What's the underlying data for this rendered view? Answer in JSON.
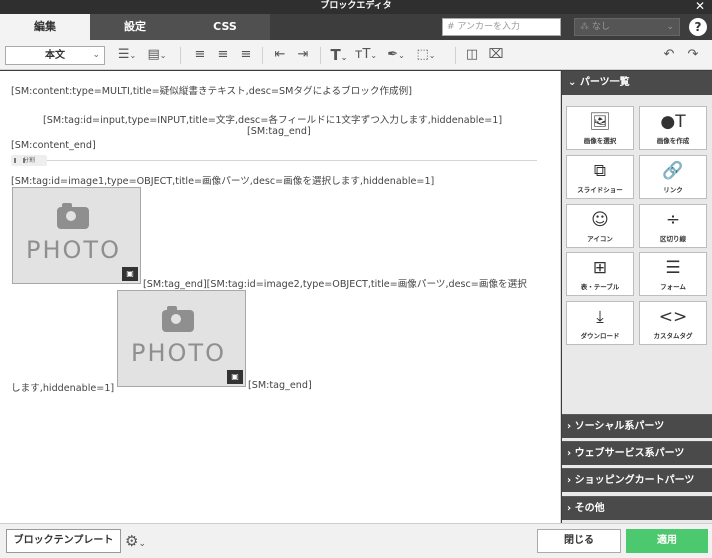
{
  "window": {
    "title": "ブロックエディタ",
    "close_symbol": "✕"
  },
  "tabs": [
    {
      "label": "編集"
    },
    {
      "label": "設定"
    },
    {
      "label": "CSS"
    }
  ],
  "anchor": {
    "placeholder": "# アンカーを入力",
    "value": ""
  },
  "link_select": {
    "value": "なし"
  },
  "help_symbol": "?",
  "toolbar": {
    "style_select": "本文"
  },
  "editor": {
    "line1": "[SM:content:type=MULTI,title=疑似縦書きテキスト,desc=SMタグによるブロック作成例]",
    "line2": "[SM:tag:id=input,type=INPUT,title=文字,desc=各フィールドに1文字ずつ入力します,hiddenable=1]",
    "line3": "[SM:tag_end]",
    "line4": "[SM:content_end]",
    "divider_label": "分割",
    "line5": "[SM:tag:id=image1,type=OBJECT,title=画像パーツ,desc=画像を選択します,hiddenable=1]",
    "photo_text": "PHOTO",
    "line6": "[SM:tag_end][SM:tag:id=image2,type=OBJECT,title=画像パーツ,desc=画像を選択",
    "line7": "します,hiddenable=1]",
    "line8": "[SM:tag_end]"
  },
  "sidebar": {
    "header": "パーツ一覧",
    "parts": [
      {
        "label": "画像を選択",
        "icon": "image-icon"
      },
      {
        "label": "画像を作成",
        "icon": "create-image-icon"
      },
      {
        "label": "スライドショー",
        "icon": "slideshow-icon"
      },
      {
        "label": "リンク",
        "icon": "link-icon"
      },
      {
        "label": "アイコン",
        "icon": "smiley-icon"
      },
      {
        "label": "区切り線",
        "icon": "separator-icon"
      },
      {
        "label": "表・テーブル",
        "icon": "table-icon"
      },
      {
        "label": "フォーム",
        "icon": "form-icon"
      },
      {
        "label": "ダウンロード",
        "icon": "download-icon"
      },
      {
        "label": "カスタムタグ",
        "icon": "code-icon"
      }
    ],
    "categories": [
      "ソーシャル系パーツ",
      "ウェブサービス系パーツ",
      "ショッピングカートパーツ",
      "その他"
    ]
  },
  "bottom": {
    "template_button": "ブロックテンプレート",
    "close_button": "閉じる",
    "apply_button": "適用"
  },
  "colors": {
    "apply": "#4cc86e",
    "dark": "#3d3d3d"
  }
}
